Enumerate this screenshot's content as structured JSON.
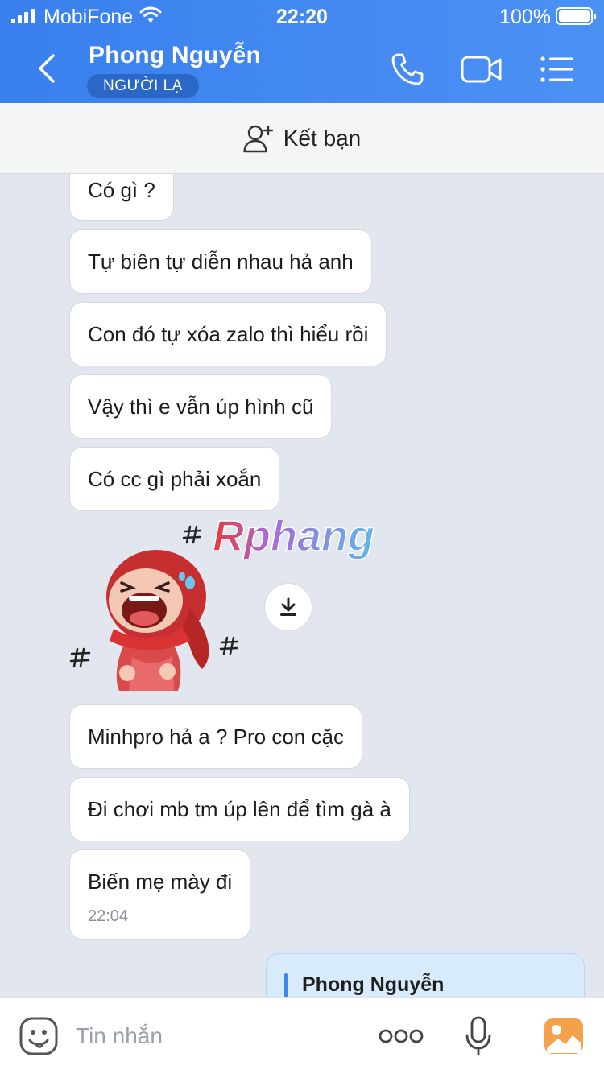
{
  "status_bar": {
    "carrier": "MobiFone",
    "time": "22:20",
    "battery_pct": "100%"
  },
  "header": {
    "name": "Phong Nguyễn",
    "badge": "NGƯỜI LẠ",
    "icons": [
      "back-chevron",
      "phone",
      "video-camera",
      "list-menu"
    ]
  },
  "friend_bar": {
    "label": "Kết bạn"
  },
  "messages": [
    {
      "text": "Có gì ?"
    },
    {
      "text": "Tự biên tự diễn nhau hả anh"
    },
    {
      "text": "Con đó tự xóa zalo thì hiểu rồi"
    },
    {
      "text": "Vậy thì e vẫn úp hình cũ"
    },
    {
      "text": "Có cc gì phải xoắn"
    },
    {
      "text": "Minhpro hả a ? Pro con cặc"
    },
    {
      "text": "Đi chơi mb tm úp lên để tìm gà à"
    },
    {
      "text": "Biến mẹ mày đi",
      "time": "22:04"
    }
  ],
  "sticker": {
    "watermark": "Rphang"
  },
  "reply": {
    "quoted_name": "Phong Nguyễn"
  },
  "input": {
    "placeholder": "Tin nhắn"
  },
  "colors": {
    "header": "#3a80ee",
    "badge": "#2b67c6",
    "chat_bg": "#e2e6ee",
    "reply_bg": "#d7ebfc"
  }
}
